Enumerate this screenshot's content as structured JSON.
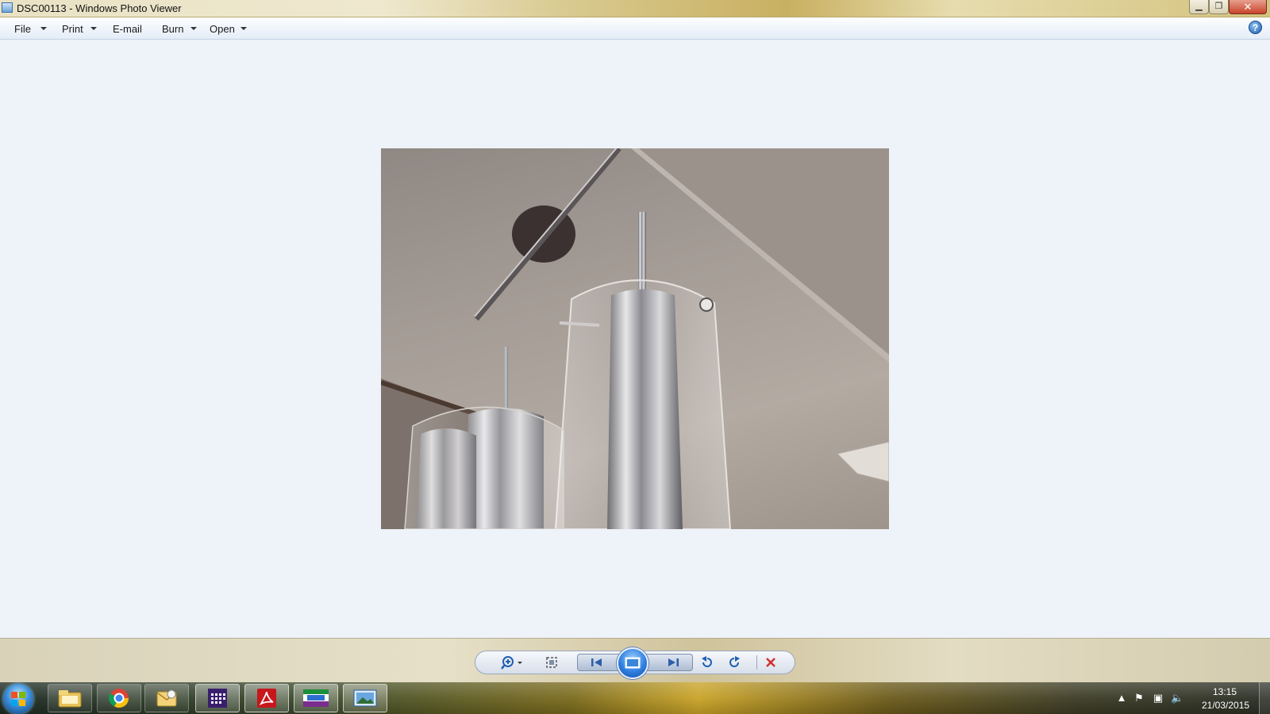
{
  "window": {
    "title": "DSC00113 - Windows Photo Viewer",
    "close_glyph": "✕",
    "min_glyph": "▁",
    "max_glyph": "❐"
  },
  "menu": {
    "items": [
      {
        "label": "File",
        "has_dropdown": true
      },
      {
        "label": "Print",
        "has_dropdown": true
      },
      {
        "label": "E-mail",
        "has_dropdown": false
      },
      {
        "label": "Burn",
        "has_dropdown": true
      },
      {
        "label": "Open",
        "has_dropdown": true
      }
    ],
    "help_glyph": "?"
  },
  "controls": {
    "icons": [
      "zoom-icon",
      "actual-size-icon",
      "previous-icon",
      "slideshow-icon",
      "next-icon",
      "rotate-counterclockwise-icon",
      "rotate-clockwise-icon",
      "delete-icon"
    ]
  },
  "taskbar": {
    "pinned": [
      "windows-explorer-icon",
      "chrome-icon",
      "outlook-icon",
      "calendar-app-icon",
      "adobe-reader-icon",
      "sage-icon",
      "photo-viewer-icon"
    ],
    "tray": {
      "time": "13:15",
      "date": "21/03/2015"
    }
  },
  "colors": {
    "viewer_bg": "#eef2f9",
    "close_red": "#c7442a",
    "delete_red": "#d0312d",
    "accent_blue": "#2f7fe0"
  }
}
